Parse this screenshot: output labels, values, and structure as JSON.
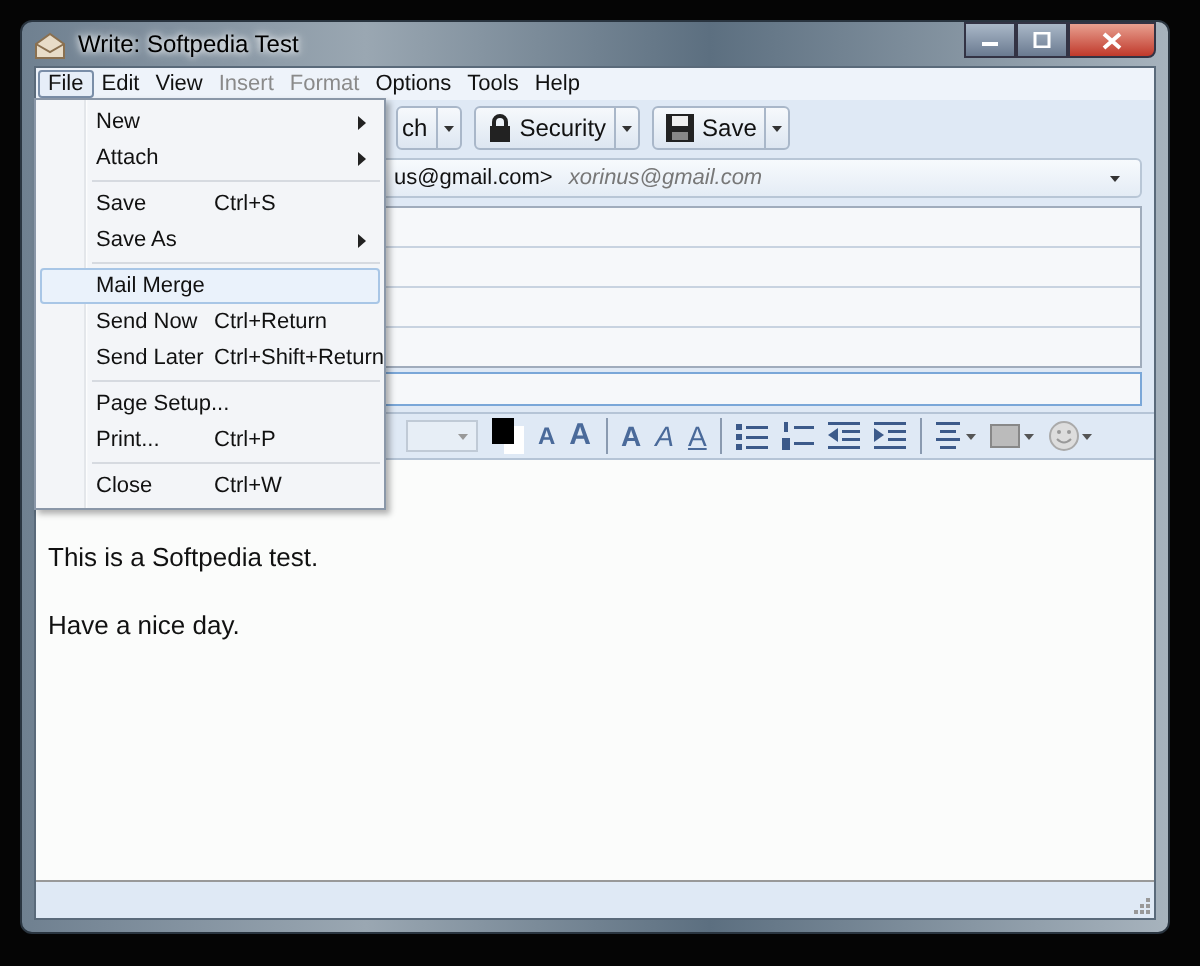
{
  "window": {
    "title": "Write: Softpedia Test"
  },
  "menu_bar": [
    {
      "label": "File",
      "selected": true,
      "disabled": false
    },
    {
      "label": "Edit",
      "selected": false,
      "disabled": false
    },
    {
      "label": "View",
      "selected": false,
      "disabled": false
    },
    {
      "label": "Insert",
      "selected": false,
      "disabled": true
    },
    {
      "label": "Format",
      "selected": false,
      "disabled": true
    },
    {
      "label": "Options",
      "selected": false,
      "disabled": false
    },
    {
      "label": "Tools",
      "selected": false,
      "disabled": false
    },
    {
      "label": "Help",
      "selected": false,
      "disabled": false
    }
  ],
  "toolbar": [
    {
      "kind": "attach",
      "label": "ch"
    },
    {
      "kind": "security",
      "label": "Security"
    },
    {
      "kind": "save",
      "label": "Save"
    }
  ],
  "from": {
    "name": "us@gmail.com>",
    "account": "xorinus@gmail.com"
  },
  "format_toolbar": [
    {
      "kind": "size-combo"
    },
    {
      "kind": "color"
    },
    {
      "kind": "smaller",
      "label": "A"
    },
    {
      "kind": "larger",
      "label": "A"
    },
    {
      "kind": "sep"
    },
    {
      "kind": "bold",
      "label": "A"
    },
    {
      "kind": "italic",
      "label": "A"
    },
    {
      "kind": "underline",
      "label": "A"
    },
    {
      "kind": "sep"
    },
    {
      "kind": "bullets"
    },
    {
      "kind": "numbers"
    },
    {
      "kind": "outdent"
    },
    {
      "kind": "indent"
    },
    {
      "kind": "sep"
    },
    {
      "kind": "align"
    },
    {
      "kind": "bgcolor"
    },
    {
      "kind": "smiley"
    }
  ],
  "body": [
    "This is a Softpedia test.",
    "Have a nice day."
  ],
  "file_menu": [
    {
      "kind": "item",
      "label": "New",
      "submenu": true,
      "selected": false
    },
    {
      "kind": "item",
      "label": "Attach",
      "submenu": true,
      "selected": false
    },
    {
      "kind": "separator"
    },
    {
      "kind": "item",
      "label": "Save",
      "shortcut": "Ctrl+S",
      "submenu": false,
      "selected": false
    },
    {
      "kind": "item",
      "label": "Save As",
      "submenu": true,
      "selected": false
    },
    {
      "kind": "separator"
    },
    {
      "kind": "item",
      "label": "Mail Merge",
      "submenu": false,
      "selected": true
    },
    {
      "kind": "item",
      "label": "Send Now",
      "shortcut": "Ctrl+Return",
      "submenu": false,
      "selected": false
    },
    {
      "kind": "item",
      "label": "Send Later",
      "shortcut": "Ctrl+Shift+Return",
      "submenu": false,
      "selected": false
    },
    {
      "kind": "separator"
    },
    {
      "kind": "item",
      "label": "Page Setup...",
      "submenu": false,
      "selected": false
    },
    {
      "kind": "item",
      "label": "Print...",
      "shortcut": "Ctrl+P",
      "submenu": false,
      "selected": false
    },
    {
      "kind": "separator"
    },
    {
      "kind": "item",
      "label": "Close",
      "shortcut": "Ctrl+W",
      "submenu": false,
      "selected": false
    }
  ]
}
